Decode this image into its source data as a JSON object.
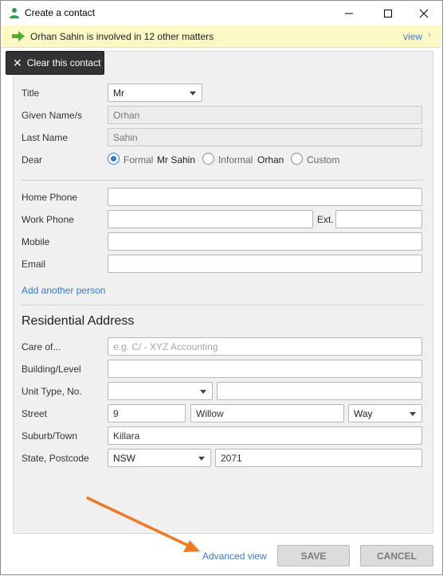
{
  "window": {
    "title": "Create a contact"
  },
  "banner": {
    "text": "Orhan Sahin is involved in 12 other matters",
    "link": "view"
  },
  "clear_button": "Clear this contact",
  "person": {
    "title_label": "Title",
    "title_value": "Mr",
    "given_label": "Given Name/s",
    "given_value": "Orhan",
    "last_label": "Last Name",
    "last_value": "Sahin",
    "dear_label": "Dear",
    "dear_options": [
      {
        "label": "Formal",
        "value": "Mr Sahin",
        "selected": true
      },
      {
        "label": "Informal",
        "value": "Orhan",
        "selected": false
      },
      {
        "label": "Custom",
        "value": "",
        "selected": false
      }
    ]
  },
  "phones": {
    "home_label": "Home Phone",
    "home_value": "",
    "work_label": "Work Phone",
    "work_value": "",
    "ext_label": "Ext.",
    "ext_value": "",
    "mobile_label": "Mobile",
    "mobile_value": "",
    "email_label": "Email",
    "email_value": ""
  },
  "add_person_link": "Add another person",
  "address": {
    "section_title": "Residential Address",
    "care_label": "Care of...",
    "care_placeholder": "e.g. C/ - XYZ Accounting",
    "building_label": "Building/Level",
    "building_value": "",
    "unit_label": "Unit Type, No.",
    "unit_type_value": "",
    "unit_no_value": "",
    "street_label": "Street",
    "street_no": "9",
    "street_name": "Willow",
    "street_type": "Way",
    "suburb_label": "Suburb/Town",
    "suburb_value": "Killara",
    "state_label": "State, Postcode",
    "state_value": "NSW",
    "postcode_value": "2071"
  },
  "footer": {
    "advanced_link": "Advanced view",
    "save": "SAVE",
    "cancel": "CANCEL"
  },
  "colors": {
    "accent": "#3a7bd5",
    "banner_bg": "#fdf9c4",
    "annotation_arrow": "#f07a22",
    "person_icon": "#2e9e47",
    "banner_arrow": "#4caf2f"
  }
}
